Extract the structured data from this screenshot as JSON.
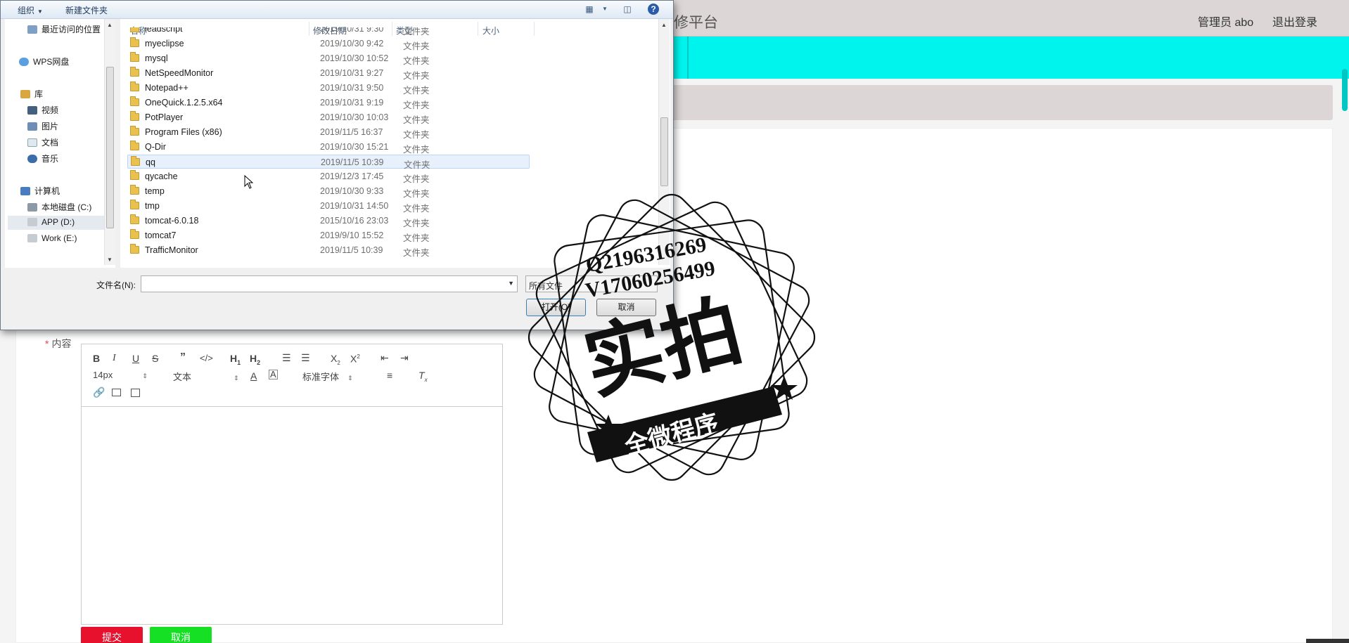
{
  "app": {
    "brand": "修平台",
    "user": "管理员 abo",
    "logout": "退出登录"
  },
  "form": {
    "content_label": "内容",
    "required_mark": "*",
    "submit": "提交",
    "cancel": "取消"
  },
  "editor_toolbar": {
    "font_size": "14px",
    "block_type": "文本",
    "font_family": "标准字体"
  },
  "dialog": {
    "toolbar": {
      "organize": "组织",
      "new_folder": "新建文件夹"
    },
    "nav": [
      {
        "label": "最近访问的位置",
        "icon": "recent-places-icon"
      },
      {
        "label": "WPS网盘",
        "icon": "cloud-icon"
      },
      {
        "label": "库",
        "icon": "library-icon"
      },
      {
        "label": "视频",
        "icon": "video-icon"
      },
      {
        "label": "图片",
        "icon": "picture-icon"
      },
      {
        "label": "文档",
        "icon": "document-icon"
      },
      {
        "label": "音乐",
        "icon": "music-icon"
      },
      {
        "label": "计算机",
        "icon": "computer-icon"
      },
      {
        "label": "本地磁盘 (C:)",
        "icon": "drive-icon"
      },
      {
        "label": "APP (D:)",
        "icon": "drive-icon"
      },
      {
        "label": "Work (E:)",
        "icon": "drive-icon"
      }
    ],
    "columns": {
      "name": "名称",
      "modified": "修改日期",
      "type": "类型",
      "size": "大小"
    },
    "files": [
      {
        "name": "leadscript",
        "date": "2019/10/31 9:30",
        "type": "文件夹"
      },
      {
        "name": "myeclipse",
        "date": "2019/10/30 9:42",
        "type": "文件夹"
      },
      {
        "name": "mysql",
        "date": "2019/10/30 10:52",
        "type": "文件夹"
      },
      {
        "name": "NetSpeedMonitor",
        "date": "2019/10/31 9:27",
        "type": "文件夹"
      },
      {
        "name": "Notepad++",
        "date": "2019/10/31 9:50",
        "type": "文件夹"
      },
      {
        "name": "OneQuick.1.2.5.x64",
        "date": "2019/10/31 9:19",
        "type": "文件夹"
      },
      {
        "name": "PotPlayer",
        "date": "2019/10/30 10:03",
        "type": "文件夹"
      },
      {
        "name": "Program Files (x86)",
        "date": "2019/11/5 16:37",
        "type": "文件夹"
      },
      {
        "name": "Q-Dir",
        "date": "2019/10/30 15:21",
        "type": "文件夹"
      },
      {
        "name": "qq",
        "date": "2019/11/5 10:39",
        "type": "文件夹"
      },
      {
        "name": "qycache",
        "date": "2019/12/3 17:45",
        "type": "文件夹"
      },
      {
        "name": "temp",
        "date": "2019/10/30 9:33",
        "type": "文件夹"
      },
      {
        "name": "tmp",
        "date": "2019/10/31 14:50",
        "type": "文件夹"
      },
      {
        "name": "tomcat-6.0.18",
        "date": "2015/10/16 23:03",
        "type": "文件夹"
      },
      {
        "name": "tomcat7",
        "date": "2019/9/10 15:52",
        "type": "文件夹"
      },
      {
        "name": "TrafficMonitor",
        "date": "2019/11/5 10:39",
        "type": "文件夹"
      }
    ],
    "filename_label": "文件名(N):",
    "filename_value": "",
    "filetype": "所有文件",
    "open": "打开(O)",
    "cancel": "取消"
  },
  "watermark": {
    "line1": "Q2196316269",
    "line2": "V17060256499",
    "big": "实拍",
    "banner": "全微程序"
  }
}
